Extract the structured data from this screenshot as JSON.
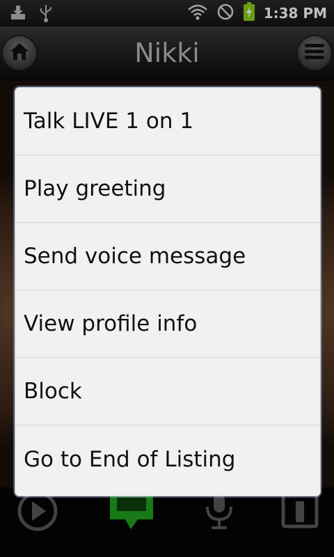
{
  "status_bar": {
    "time": "1:38 PM",
    "icons": [
      "download-icon",
      "usb-icon",
      "wifi-icon",
      "no-signal-icon",
      "battery-charging-icon"
    ]
  },
  "header": {
    "title": "Nikki",
    "left_button_icon": "home-icon",
    "right_button_icon": "menu-icon"
  },
  "menu": {
    "items": [
      {
        "label": "Talk LIVE 1 on 1"
      },
      {
        "label": "Play greeting"
      },
      {
        "label": "Send voice message"
      },
      {
        "label": "View profile info"
      },
      {
        "label": "Block"
      },
      {
        "label": "Go to End of Listing"
      }
    ]
  },
  "bottom_bar": {
    "icons": [
      "play-icon",
      "live-chat-icon",
      "microphone-icon",
      "info-icon"
    ]
  },
  "colors": {
    "dialog_bg": "#f1f1f1",
    "accent_green": "#1fa31f"
  }
}
